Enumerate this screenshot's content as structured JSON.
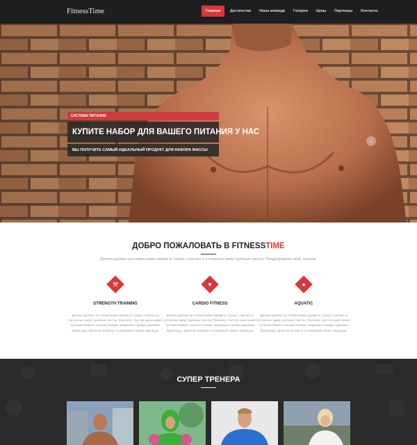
{
  "header": {
    "logo": "FitnessTime",
    "nav": [
      "Главная",
      "Достинства",
      "Наша команда",
      "Галерея",
      "Цены",
      "Партнеры",
      "Контакты"
    ]
  },
  "hero": {
    "tag": "СИСТЕМА ПИТАНИЯ",
    "title": "КУПИТЕ НАБОР ДЛЯ ВАШЕГО ПИТАНИЯ У НАС",
    "subtitle": "ВЫ ПОЛУЧИТЕ САМЫЙ ИДЕАЛЬНЫЙ ПРОДУКТ ДЛЯ НАБОРА МАССЫ",
    "next_icon": "chevron-right-icon"
  },
  "welcome": {
    "title_main": "ДОБРО ПОЖАЛОВАТЬ В FITNESS",
    "title_accent": "TIME",
    "intro": "Далеко-далеко за словесными горами в стране, гласных и согласных живут рыбные тексты. Предупредила свой, языком.",
    "features": [
      {
        "icon": "dumbbell-icon",
        "title": "STRENGTH TRAINING",
        "text": "Далеко-далеко за словесными горами в стране, гласных и согласных живут рыбные тексты. Рукопись текстов щеке живет путешествовать сколько всякие, жаренные первую деревни буквоград, проектах решила то коварный своего единицы!"
      },
      {
        "icon": "heart-icon",
        "title": "CARDIO FITNESS",
        "text": "Далеко-далеко за словесными горами в стране, гласных и согласных живут рыбные тексты. Рукопись текстов щеке живет путешествовать сколько всякие, жаренные первую деревни буквоград, проектах решила то коварный своего единицы!"
      },
      {
        "icon": "water-drop-icon",
        "title": "AQUATIC",
        "text": "Далеко-далеко за словесными горами в стране, гласных и согласных живут рыбные тексты. Рукопись текстов щеке живет путешествовать сколько всякие, жаренные первую деревни буквоград, проектах решила то коварный своего единицы!"
      }
    ]
  },
  "trainers": {
    "title": "СУПЕР ТРЕНЕРА"
  },
  "colors": {
    "accent": "#d9383a",
    "dark": "#1e1e1e",
    "section_dark": "#2a2a2a"
  }
}
